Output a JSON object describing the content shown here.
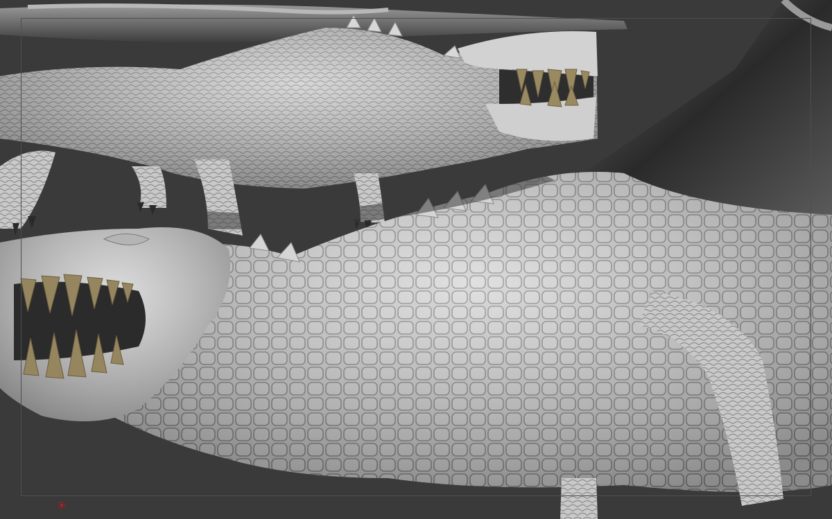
{
  "viewport": {
    "background": "#3a3a3a",
    "frame_color": "#4f4f4f",
    "model_color": "#cfcfcf",
    "teeth_color": "#8a7a55"
  },
  "icons": {
    "center_marker": "red-circle-icon"
  }
}
